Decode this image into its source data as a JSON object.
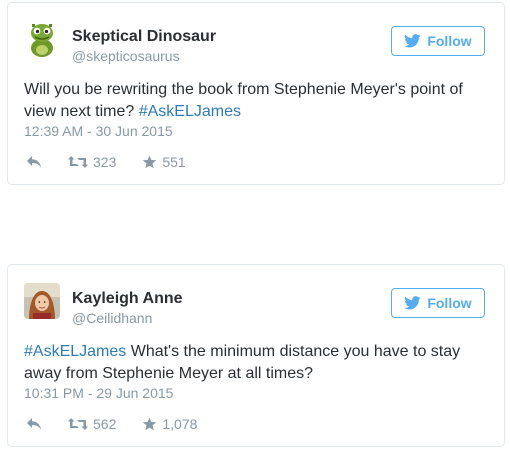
{
  "tweets": [
    {
      "author_name": "Skeptical Dinosaur",
      "handle": "@skepticosaurus",
      "follow_label": "Follow",
      "text_before": "Will you be rewriting the book from Stephenie Meyer's point of view next time? ",
      "hashtag": "#AskELJames",
      "text_after": "",
      "timestamp": "12:39 AM - 30 Jun 2015",
      "retweets": "323",
      "favorites": "551",
      "avatar": "green-dinosaur-avatar"
    },
    {
      "author_name": "Kayleigh Anne",
      "handle": "@Ceilidhann",
      "follow_label": "Follow",
      "text_before": "",
      "hashtag": "#AskELJames",
      "text_after": " What's the minimum distance you have to stay away from Stephenie Meyer at all times?",
      "timestamp": "10:31 PM - 29 Jun 2015",
      "retweets": "562",
      "favorites": "1,078",
      "avatar": "photo-avatar"
    }
  ],
  "colors": {
    "accent": "#55acee",
    "hashtag": "#2b7bb9",
    "muted": "#8899a6",
    "text": "#292f33",
    "border": "#e1e8ed"
  }
}
